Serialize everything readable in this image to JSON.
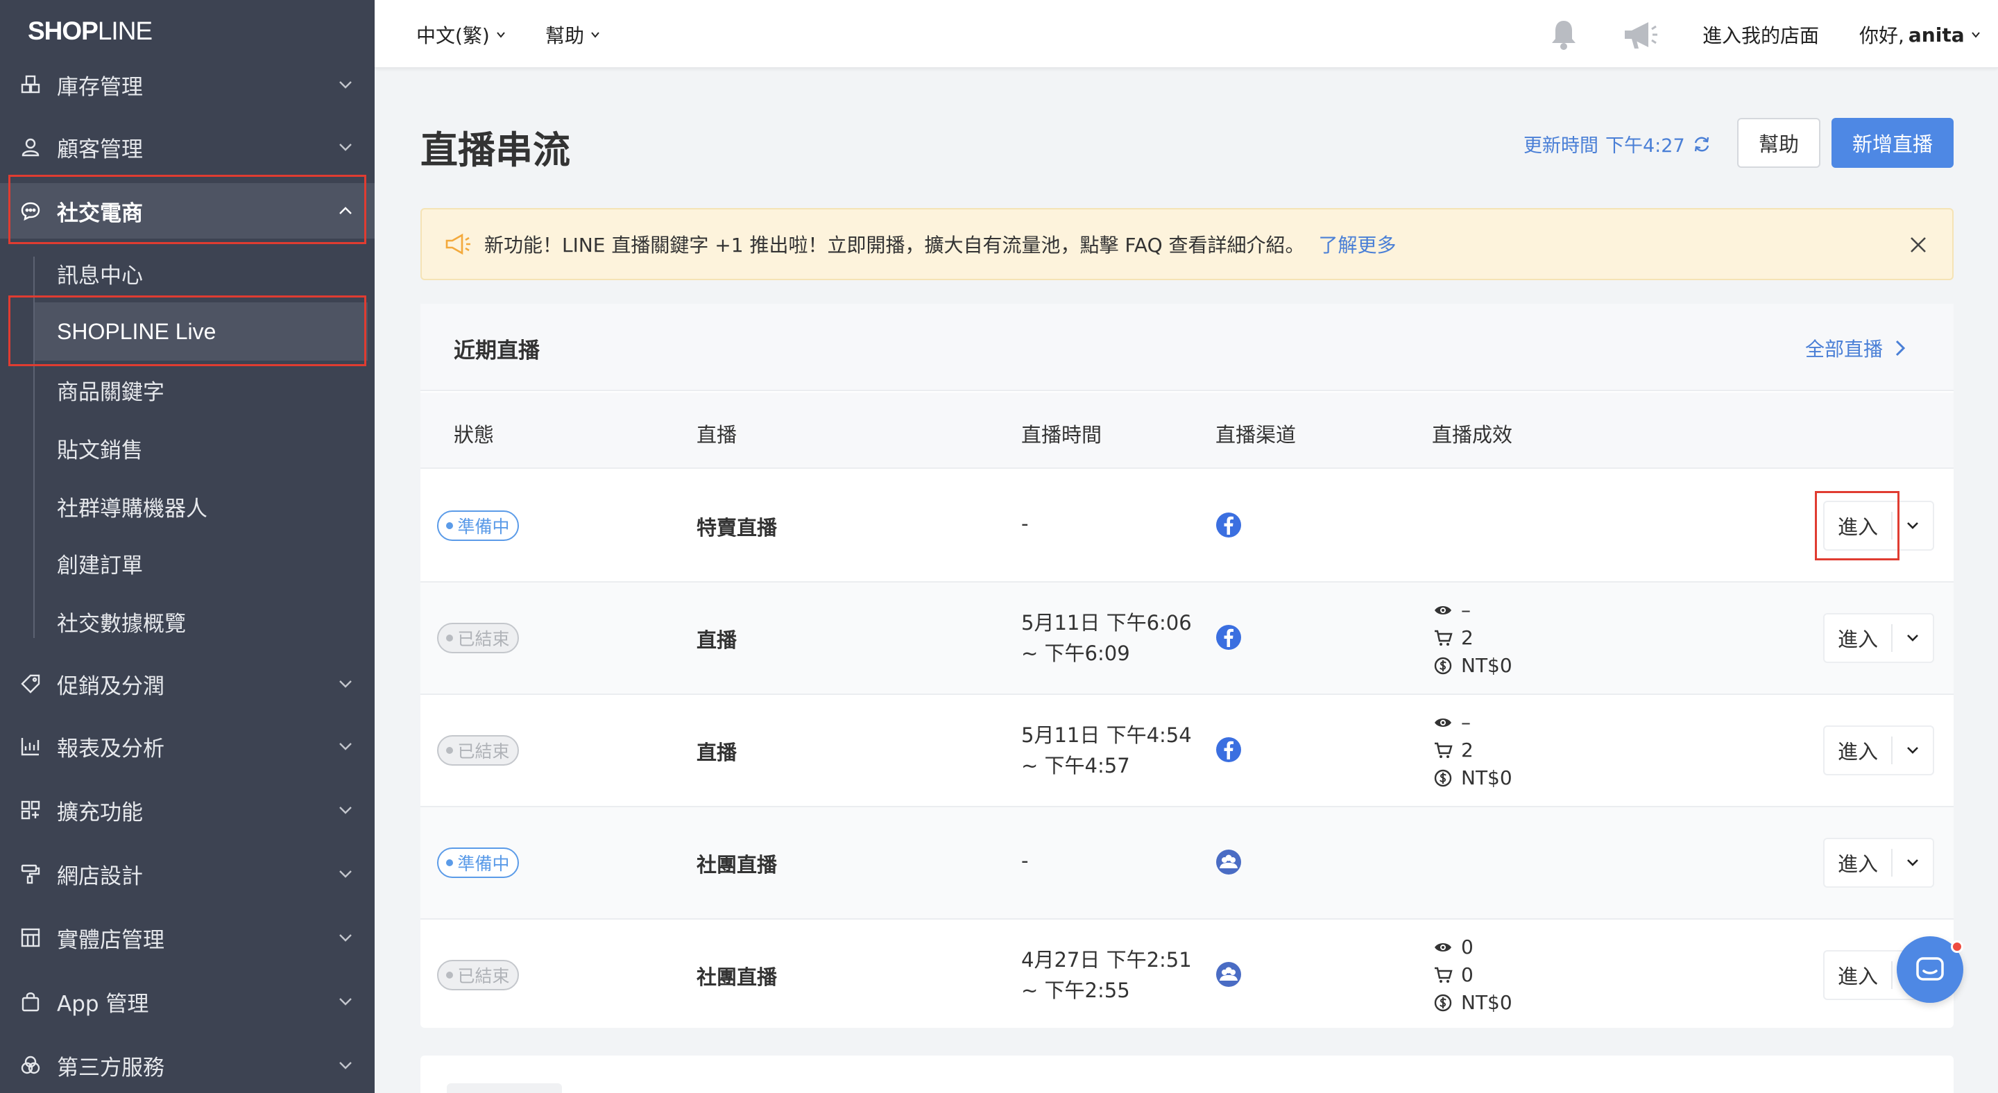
{
  "sidebar": {
    "logo_bold": "SHOP",
    "logo_thin": "LINE",
    "items": [
      {
        "label": "庫存管理"
      },
      {
        "label": "顧客管理"
      },
      {
        "label": "社交電商"
      },
      {
        "label": "促銷及分潤"
      },
      {
        "label": "報表及分析"
      },
      {
        "label": "擴充功能"
      },
      {
        "label": "網店設計"
      },
      {
        "label": "實體店管理"
      },
      {
        "label": "App 管理"
      },
      {
        "label": "第三方服務"
      }
    ],
    "sub_items": [
      {
        "label": "訊息中心"
      },
      {
        "label": "SHOPLINE Live"
      },
      {
        "label": "商品關鍵字"
      },
      {
        "label": "貼文銷售"
      },
      {
        "label": "社群導購機器人"
      },
      {
        "label": "創建訂單"
      },
      {
        "label": "社交數據概覽"
      }
    ]
  },
  "topbar": {
    "language": "中文(繁)",
    "help": "幫助",
    "enter_store": "進入我的店面",
    "greeting": "你好,",
    "username": "anita"
  },
  "page": {
    "title": "直播串流",
    "update_label": "更新時間",
    "update_time": "下午4:27",
    "help_button": "幫助",
    "new_button": "新增直播"
  },
  "banner": {
    "message": "新功能！LINE 直播關鍵字 +1 推出啦！立即開播，擴大自有流量池，點擊 FAQ 查看詳細介紹。",
    "link": "了解更多"
  },
  "recent": {
    "title": "近期直播",
    "view_all": "全部直播",
    "headers": [
      "狀態",
      "直播",
      "直播時間",
      "直播渠道",
      "直播成效"
    ],
    "enter_label": "進入",
    "rows": [
      {
        "status": "準備中",
        "status_type": "preparing",
        "name": "特賣直播",
        "time1": "-",
        "time2": "",
        "channel": "facebook-icon",
        "views": "",
        "carts": "",
        "sales": ""
      },
      {
        "status": "已結束",
        "status_type": "ended",
        "name": "直播",
        "time1": "5月11日 下午6:06",
        "time2": "~ 下午6:09",
        "channel": "facebook-icon",
        "views": "–",
        "carts": "2",
        "sales": "NT$0"
      },
      {
        "status": "已結束",
        "status_type": "ended",
        "name": "直播",
        "time1": "5月11日 下午4:54",
        "time2": "~ 下午4:57",
        "channel": "facebook-icon",
        "views": "–",
        "carts": "2",
        "sales": "NT$0"
      },
      {
        "status": "準備中",
        "status_type": "preparing",
        "name": "社團直播",
        "time1": "-",
        "time2": "",
        "channel": "group-icon",
        "views": "",
        "carts": "",
        "sales": ""
      },
      {
        "status": "已結束",
        "status_type": "ended",
        "name": "社團直播",
        "time1": "4月27日 下午2:51",
        "time2": "~ 下午2:55",
        "channel": "group-icon",
        "views": "0",
        "carts": "0",
        "sales": "NT$0"
      }
    ]
  },
  "colors": {
    "sidebar_bg": "#3d4352",
    "accent": "#4e88e4",
    "banner_bg": "#fdf3dc",
    "highlight": "#e03c31"
  }
}
